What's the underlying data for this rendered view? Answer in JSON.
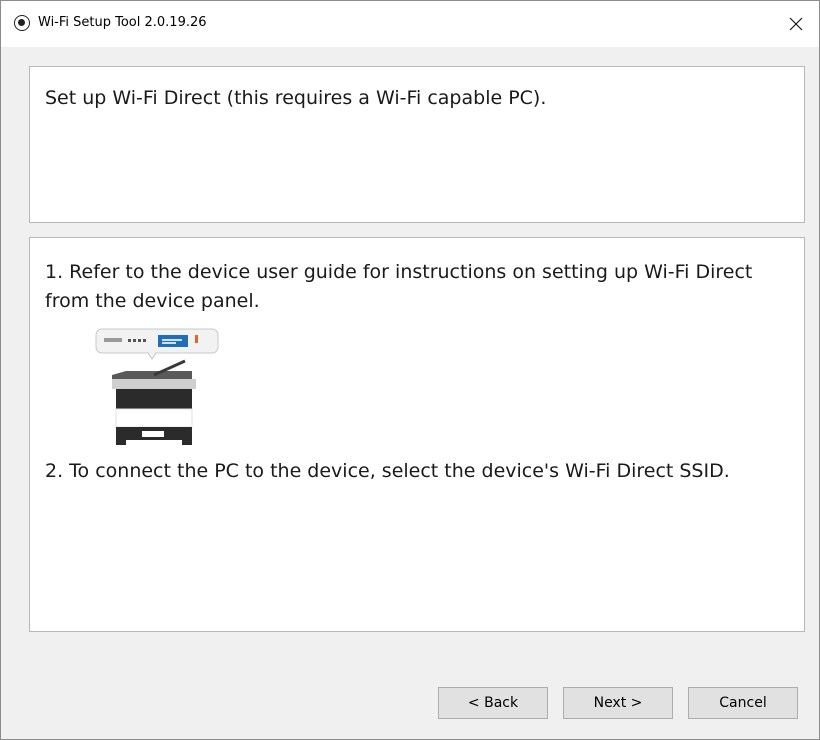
{
  "window": {
    "title": "Wi-Fi Setup Tool 2.0.19.26",
    "icon": "app-icon",
    "close_icon": "close-icon"
  },
  "top_panel": {
    "heading": "Set up Wi-Fi Direct (this requires a Wi-Fi capable PC)."
  },
  "main_panel": {
    "step1": "1. Refer to the device user guide for instructions on setting up Wi-Fi Direct from the device panel.",
    "illustration": "printer-illustration",
    "step2": "2. To connect the PC to the device, select the device's Wi-Fi Direct SSID."
  },
  "buttons": {
    "back": "< Back",
    "next": "Next >",
    "cancel": "Cancel"
  },
  "colors": {
    "window_bg": "#f0f0f0",
    "panel_bg": "#ffffff",
    "accent_blue": "#1f6fb8",
    "accent_orange": "#e8612c"
  }
}
